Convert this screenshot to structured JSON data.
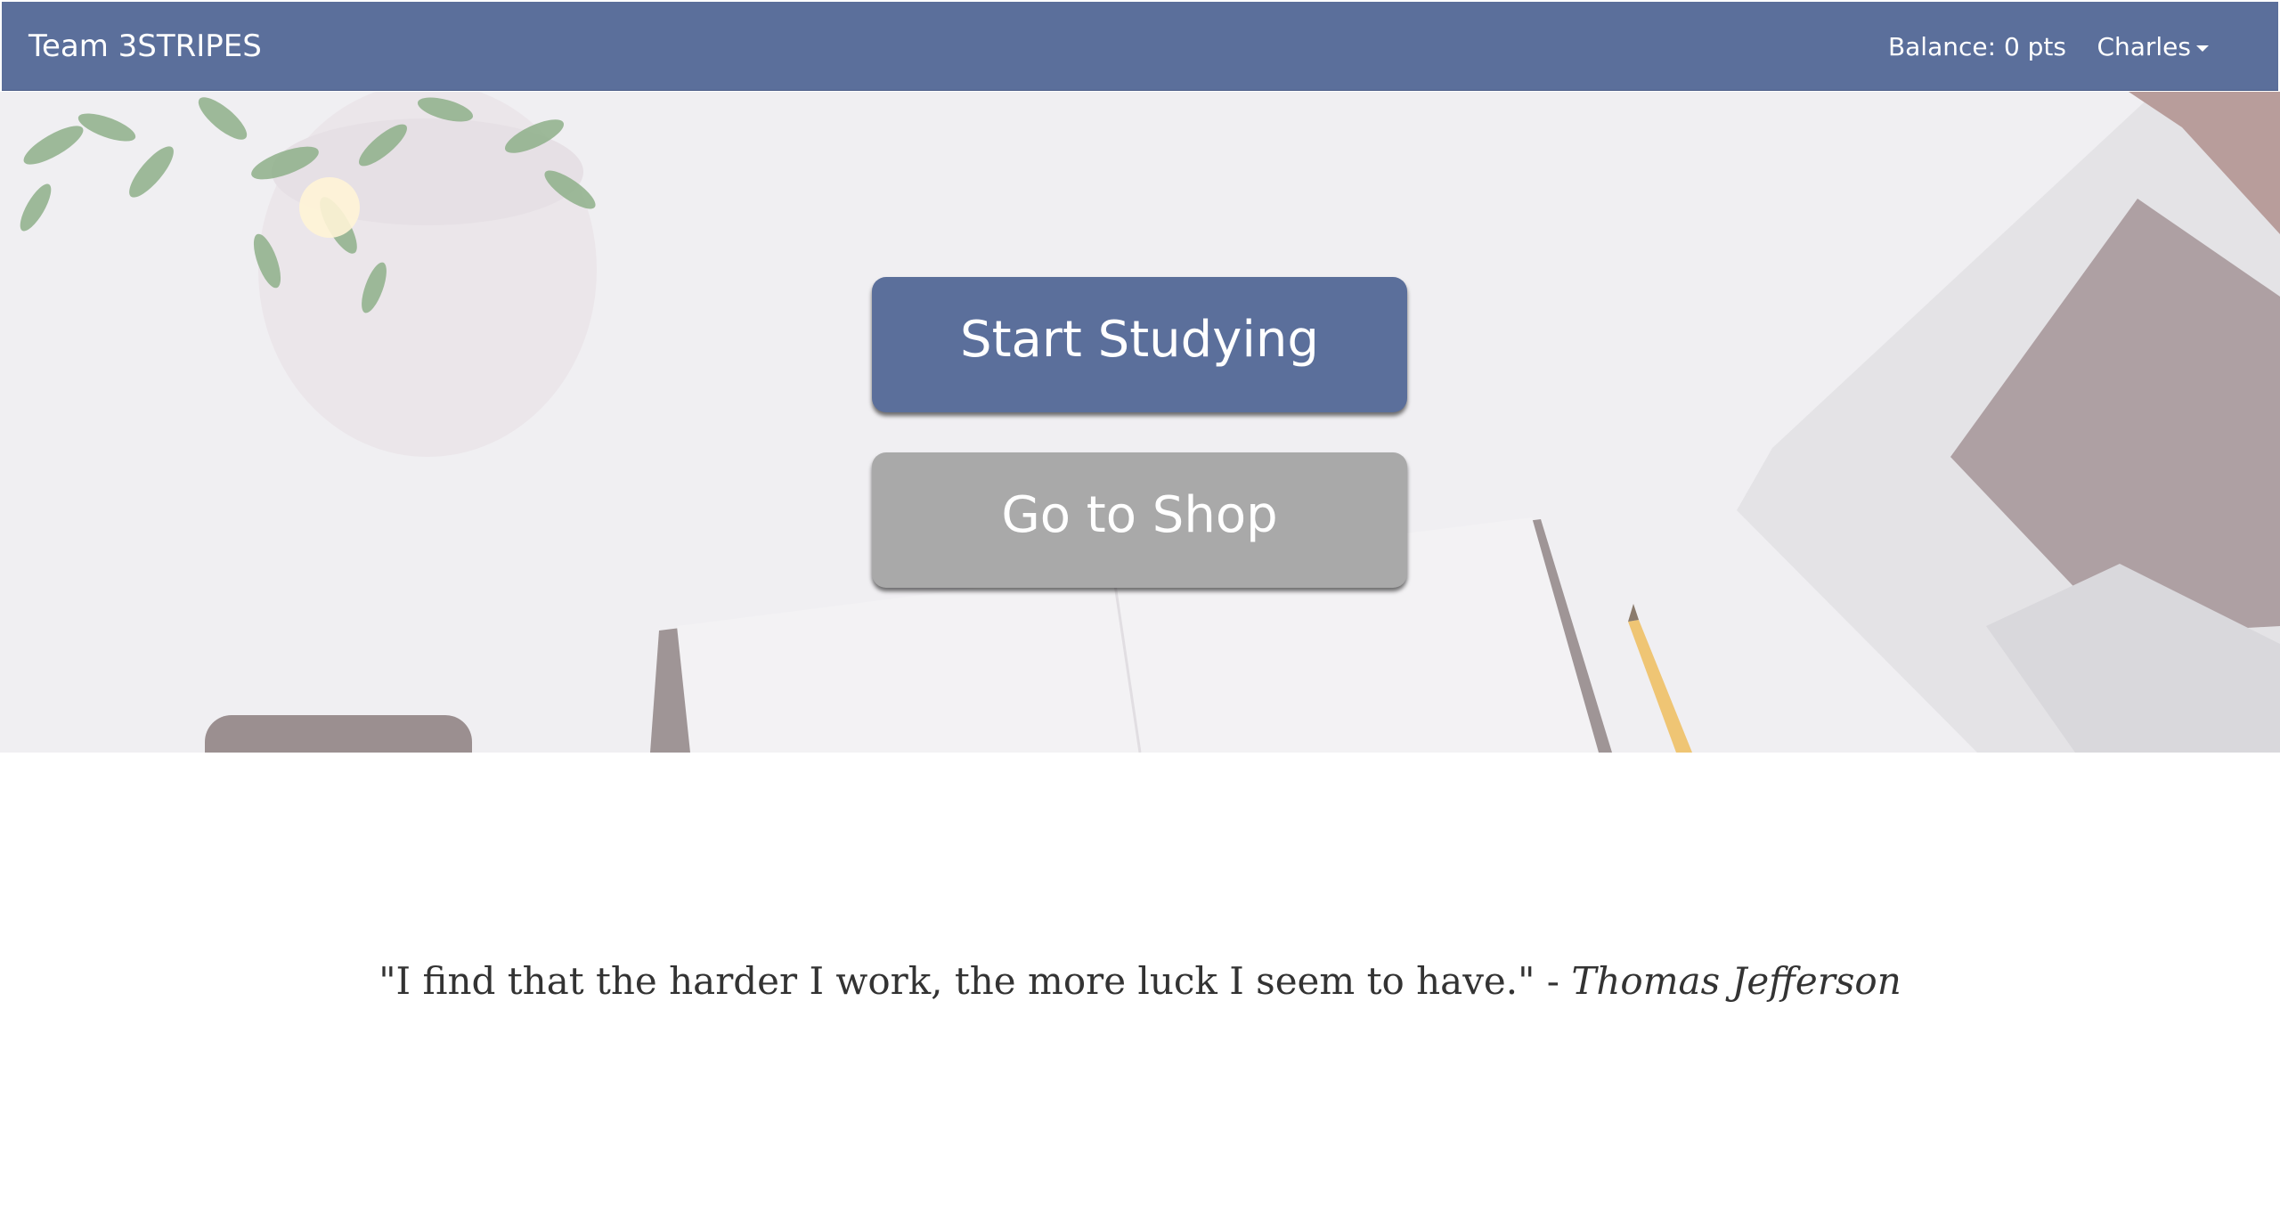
{
  "navbar": {
    "brand": "Team 3STRIPES",
    "balance": "Balance: 0 pts",
    "user_name": "Charles",
    "color": "#5b6f9b"
  },
  "hero": {
    "start_button": "Start Studying",
    "shop_button": "Go to Shop",
    "start_color": "#5b6f9b",
    "shop_color": "#a9a9a9"
  },
  "quote": {
    "text": "\"I find that the harder I work, the more luck I seem to have.\"",
    "separator": " - ",
    "author": "Thomas Jefferson"
  },
  "icons": {
    "user_menu": "chevron-down-icon"
  }
}
